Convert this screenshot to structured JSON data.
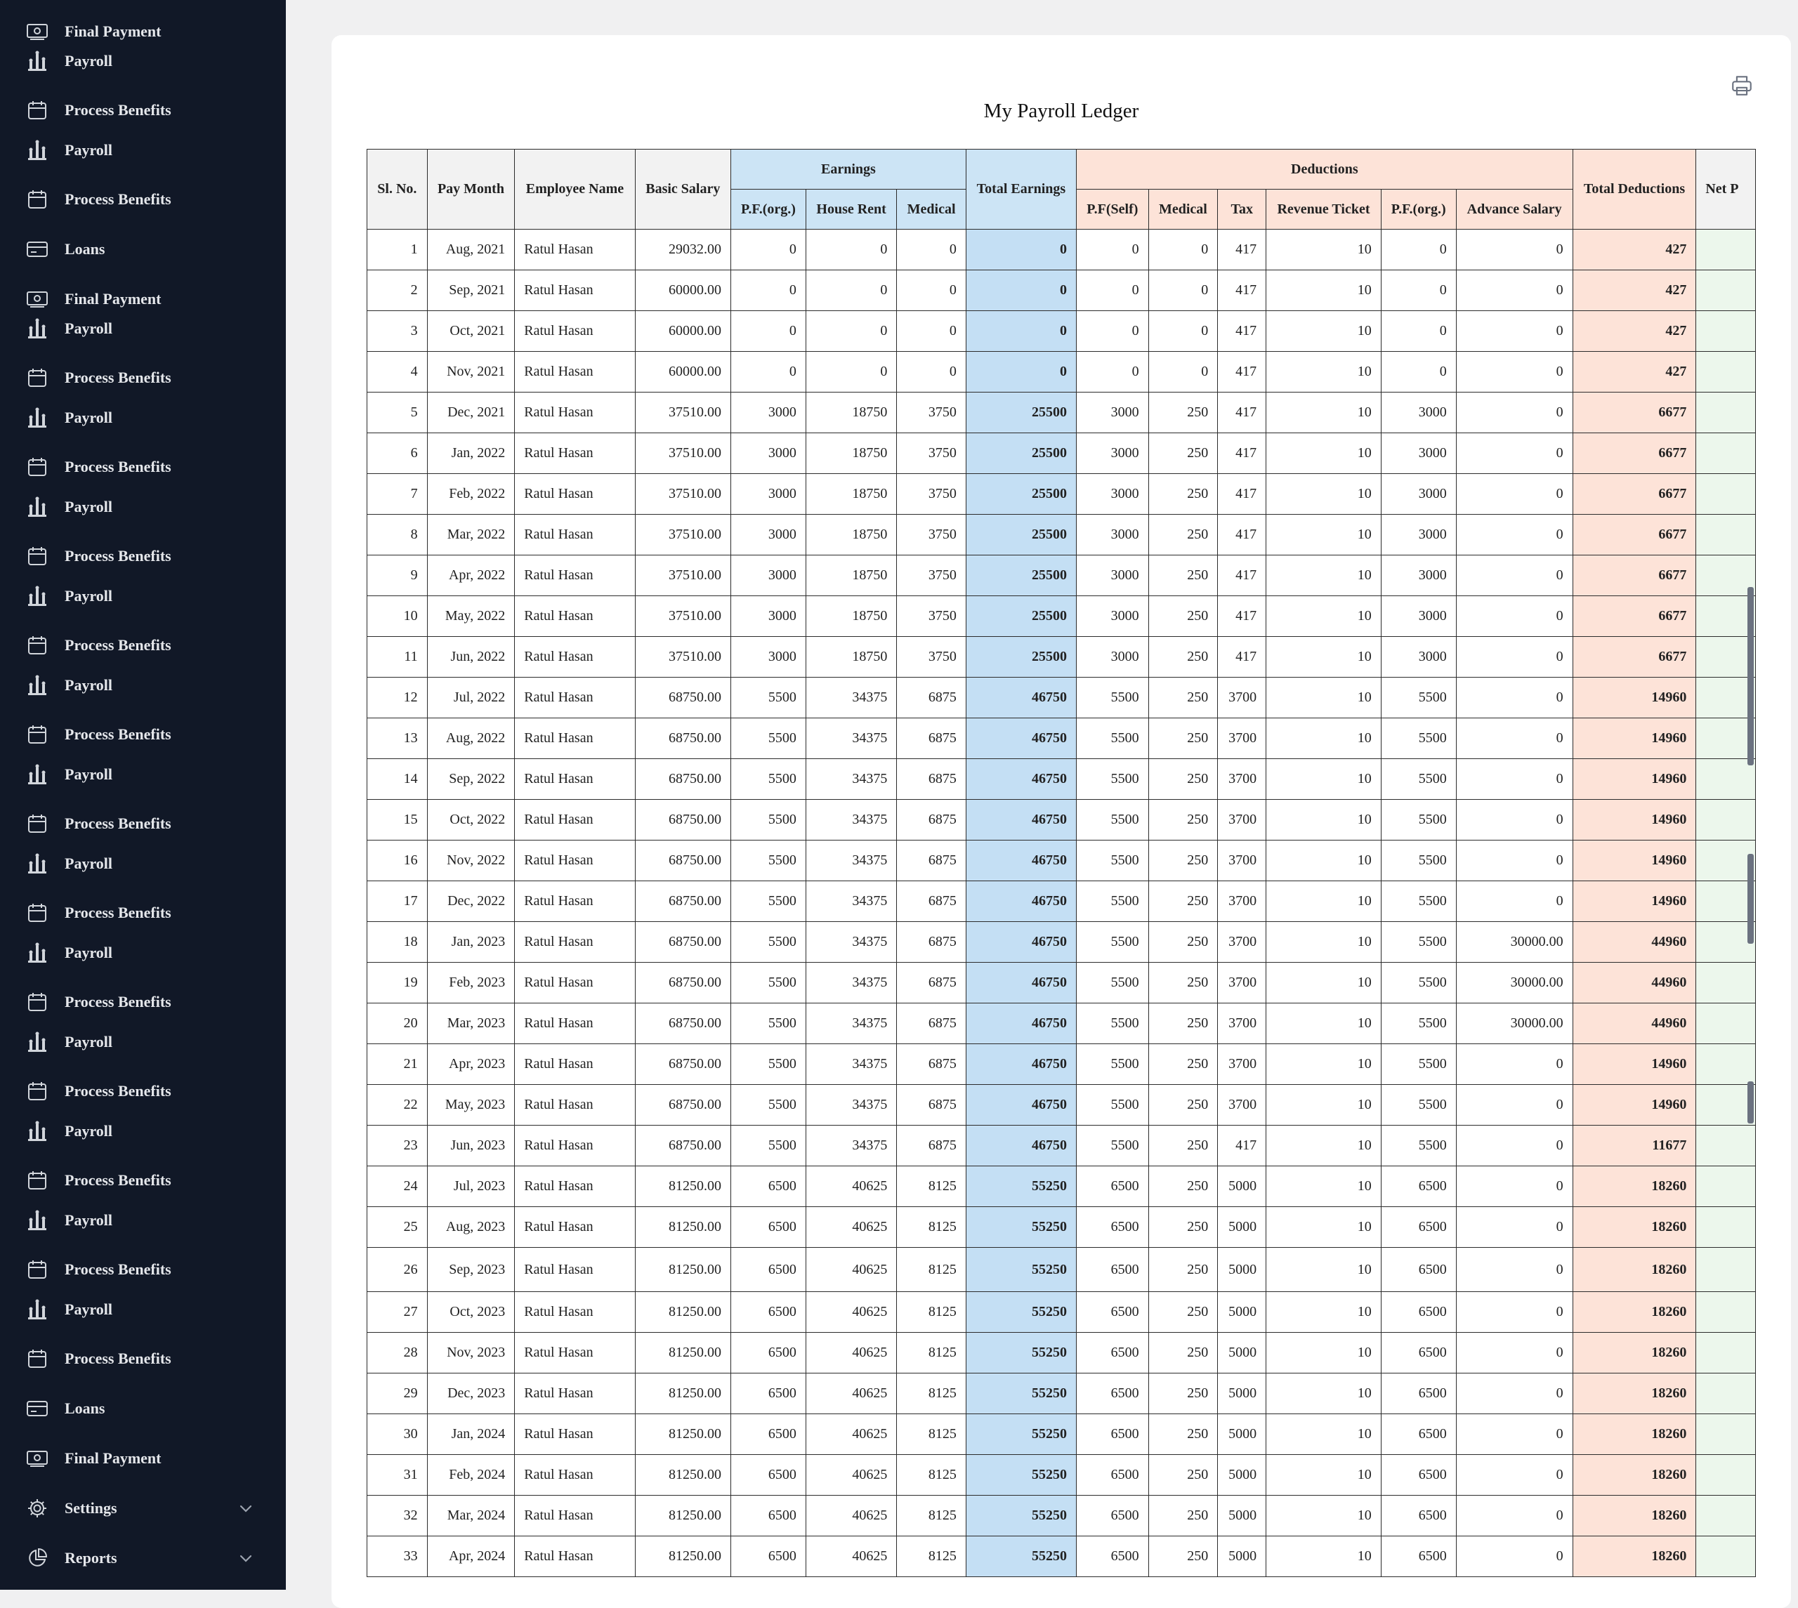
{
  "sidebar": {
    "items": [
      {
        "label": "Final Payment",
        "icon": "cash-icon"
      },
      {
        "label": "Payroll",
        "icon": "chess-icon"
      },
      {
        "label": "Process Benefits",
        "icon": "calendar-icon"
      },
      {
        "label": "Payroll",
        "icon": "chess-icon"
      },
      {
        "label": "Process Benefits",
        "icon": "calendar-icon"
      },
      {
        "label": "Loans",
        "icon": "card-icon"
      },
      {
        "label": "Final Payment",
        "icon": "cash-icon"
      },
      {
        "label": "Payroll",
        "icon": "chess-icon"
      },
      {
        "label": "Process Benefits",
        "icon": "calendar-icon"
      },
      {
        "label": "Payroll",
        "icon": "chess-icon"
      },
      {
        "label": "Process Benefits",
        "icon": "calendar-icon"
      },
      {
        "label": "Payroll",
        "icon": "chess-icon"
      },
      {
        "label": "Process Benefits",
        "icon": "calendar-icon"
      },
      {
        "label": "Payroll",
        "icon": "chess-icon"
      },
      {
        "label": "Process Benefits",
        "icon": "calendar-icon"
      },
      {
        "label": "Payroll",
        "icon": "chess-icon"
      },
      {
        "label": "Process Benefits",
        "icon": "calendar-icon"
      },
      {
        "label": "Payroll",
        "icon": "chess-icon"
      },
      {
        "label": "Process Benefits",
        "icon": "calendar-icon"
      },
      {
        "label": "Payroll",
        "icon": "chess-icon"
      },
      {
        "label": "Process Benefits",
        "icon": "calendar-icon"
      },
      {
        "label": "Payroll",
        "icon": "chess-icon"
      },
      {
        "label": "Process Benefits",
        "icon": "calendar-icon"
      },
      {
        "label": "Payroll",
        "icon": "chess-icon"
      },
      {
        "label": "Process Benefits",
        "icon": "calendar-icon"
      },
      {
        "label": "Payroll",
        "icon": "chess-icon"
      },
      {
        "label": "Process Benefits",
        "icon": "calendar-icon"
      },
      {
        "label": "Payroll",
        "icon": "chess-icon"
      },
      {
        "label": "Process Benefits",
        "icon": "calendar-icon"
      },
      {
        "label": "Payroll",
        "icon": "chess-icon"
      },
      {
        "label": "Process Benefits",
        "icon": "calendar-icon"
      },
      {
        "label": "Loans",
        "icon": "card-icon"
      },
      {
        "label": "Final Payment",
        "icon": "cash-icon"
      },
      {
        "label": "Settings",
        "icon": "gear-icon",
        "expandable": true
      },
      {
        "label": "Reports",
        "icon": "pie-chart-icon",
        "expandable": true
      }
    ]
  },
  "page": {
    "title": "My Payroll Ledger"
  },
  "table": {
    "headers": {
      "sl_no": "Sl. No.",
      "pay_month": "Pay Month",
      "employee_name": "Employee Name",
      "basic_salary": "Basic Salary",
      "earnings": "Earnings",
      "earn_pf_org": "P.F.(org.)",
      "earn_house_rent": "House Rent",
      "earn_medical": "Medical",
      "total_earnings": "Total Earnings",
      "deductions": "Deductions",
      "ded_pf_self": "P.F(Self)",
      "ded_medical": "Medical",
      "ded_tax": "Tax",
      "ded_revenue_ticket": "Revenue Ticket",
      "ded_pf_org": "P.F.(org.)",
      "ded_advance_salary": "Advance Salary",
      "total_deductions": "Total Deductions",
      "net_pay": "Net P"
    },
    "rows": [
      [
        "1",
        "Aug, 2021",
        "Ratul Hasan",
        "29032.00",
        "0",
        "0",
        "0",
        "0",
        "0",
        "0",
        "417",
        "10",
        "0",
        "0",
        "427",
        ""
      ],
      [
        "2",
        "Sep, 2021",
        "Ratul Hasan",
        "60000.00",
        "0",
        "0",
        "0",
        "0",
        "0",
        "0",
        "417",
        "10",
        "0",
        "0",
        "427",
        ""
      ],
      [
        "3",
        "Oct, 2021",
        "Ratul Hasan",
        "60000.00",
        "0",
        "0",
        "0",
        "0",
        "0",
        "0",
        "417",
        "10",
        "0",
        "0",
        "427",
        ""
      ],
      [
        "4",
        "Nov, 2021",
        "Ratul Hasan",
        "60000.00",
        "0",
        "0",
        "0",
        "0",
        "0",
        "0",
        "417",
        "10",
        "0",
        "0",
        "427",
        ""
      ],
      [
        "5",
        "Dec, 2021",
        "Ratul Hasan",
        "37510.00",
        "3000",
        "18750",
        "3750",
        "25500",
        "3000",
        "250",
        "417",
        "10",
        "3000",
        "0",
        "6677",
        ""
      ],
      [
        "6",
        "Jan, 2022",
        "Ratul Hasan",
        "37510.00",
        "3000",
        "18750",
        "3750",
        "25500",
        "3000",
        "250",
        "417",
        "10",
        "3000",
        "0",
        "6677",
        ""
      ],
      [
        "7",
        "Feb, 2022",
        "Ratul Hasan",
        "37510.00",
        "3000",
        "18750",
        "3750",
        "25500",
        "3000",
        "250",
        "417",
        "10",
        "3000",
        "0",
        "6677",
        ""
      ],
      [
        "8",
        "Mar, 2022",
        "Ratul Hasan",
        "37510.00",
        "3000",
        "18750",
        "3750",
        "25500",
        "3000",
        "250",
        "417",
        "10",
        "3000",
        "0",
        "6677",
        ""
      ],
      [
        "9",
        "Apr, 2022",
        "Ratul Hasan",
        "37510.00",
        "3000",
        "18750",
        "3750",
        "25500",
        "3000",
        "250",
        "417",
        "10",
        "3000",
        "0",
        "6677",
        ""
      ],
      [
        "10",
        "May, 2022",
        "Ratul Hasan",
        "37510.00",
        "3000",
        "18750",
        "3750",
        "25500",
        "3000",
        "250",
        "417",
        "10",
        "3000",
        "0",
        "6677",
        ""
      ],
      [
        "11",
        "Jun, 2022",
        "Ratul Hasan",
        "37510.00",
        "3000",
        "18750",
        "3750",
        "25500",
        "3000",
        "250",
        "417",
        "10",
        "3000",
        "0",
        "6677",
        ""
      ],
      [
        "12",
        "Jul, 2022",
        "Ratul Hasan",
        "68750.00",
        "5500",
        "34375",
        "6875",
        "46750",
        "5500",
        "250",
        "3700",
        "10",
        "5500",
        "0",
        "14960",
        ""
      ],
      [
        "13",
        "Aug, 2022",
        "Ratul Hasan",
        "68750.00",
        "5500",
        "34375",
        "6875",
        "46750",
        "5500",
        "250",
        "3700",
        "10",
        "5500",
        "0",
        "14960",
        ""
      ],
      [
        "14",
        "Sep, 2022",
        "Ratul Hasan",
        "68750.00",
        "5500",
        "34375",
        "6875",
        "46750",
        "5500",
        "250",
        "3700",
        "10",
        "5500",
        "0",
        "14960",
        ""
      ],
      [
        "15",
        "Oct, 2022",
        "Ratul Hasan",
        "68750.00",
        "5500",
        "34375",
        "6875",
        "46750",
        "5500",
        "250",
        "3700",
        "10",
        "5500",
        "0",
        "14960",
        ""
      ],
      [
        "16",
        "Nov, 2022",
        "Ratul Hasan",
        "68750.00",
        "5500",
        "34375",
        "6875",
        "46750",
        "5500",
        "250",
        "3700",
        "10",
        "5500",
        "0",
        "14960",
        ""
      ],
      [
        "17",
        "Dec, 2022",
        "Ratul Hasan",
        "68750.00",
        "5500",
        "34375",
        "6875",
        "46750",
        "5500",
        "250",
        "3700",
        "10",
        "5500",
        "0",
        "14960",
        ""
      ],
      [
        "18",
        "Jan, 2023",
        "Ratul Hasan",
        "68750.00",
        "5500",
        "34375",
        "6875",
        "46750",
        "5500",
        "250",
        "3700",
        "10",
        "5500",
        "30000.00",
        "44960",
        ""
      ],
      [
        "19",
        "Feb, 2023",
        "Ratul Hasan",
        "68750.00",
        "5500",
        "34375",
        "6875",
        "46750",
        "5500",
        "250",
        "3700",
        "10",
        "5500",
        "30000.00",
        "44960",
        ""
      ],
      [
        "20",
        "Mar, 2023",
        "Ratul Hasan",
        "68750.00",
        "5500",
        "34375",
        "6875",
        "46750",
        "5500",
        "250",
        "3700",
        "10",
        "5500",
        "30000.00",
        "44960",
        ""
      ],
      [
        "21",
        "Apr, 2023",
        "Ratul Hasan",
        "68750.00",
        "5500",
        "34375",
        "6875",
        "46750",
        "5500",
        "250",
        "3700",
        "10",
        "5500",
        "0",
        "14960",
        ""
      ],
      [
        "22",
        "May, 2023",
        "Ratul Hasan",
        "68750.00",
        "5500",
        "34375",
        "6875",
        "46750",
        "5500",
        "250",
        "3700",
        "10",
        "5500",
        "0",
        "14960",
        ""
      ],
      [
        "23",
        "Jun, 2023",
        "Ratul Hasan",
        "68750.00",
        "5500",
        "34375",
        "6875",
        "46750",
        "5500",
        "250",
        "417",
        "10",
        "5500",
        "0",
        "11677",
        ""
      ],
      [
        "24",
        "Jul, 2023",
        "Ratul Hasan",
        "81250.00",
        "6500",
        "40625",
        "8125",
        "55250",
        "6500",
        "250",
        "5000",
        "10",
        "6500",
        "0",
        "18260",
        ""
      ],
      [
        "25",
        "Aug, 2023",
        "Ratul Hasan",
        "81250.00",
        "6500",
        "40625",
        "8125",
        "55250",
        "6500",
        "250",
        "5000",
        "10",
        "6500",
        "0",
        "18260",
        ""
      ],
      [
        "26",
        "Sep, 2023",
        "Ratul Hasan",
        "81250.00",
        "6500",
        "40625",
        "8125",
        "55250",
        "6500",
        "250",
        "5000",
        "10",
        "6500",
        "0",
        "18260",
        ""
      ],
      [
        "27",
        "Oct, 2023",
        "Ratul Hasan",
        "81250.00",
        "6500",
        "40625",
        "8125",
        "55250",
        "6500",
        "250",
        "5000",
        "10",
        "6500",
        "0",
        "18260",
        ""
      ],
      [
        "28",
        "Nov, 2023",
        "Ratul Hasan",
        "81250.00",
        "6500",
        "40625",
        "8125",
        "55250",
        "6500",
        "250",
        "5000",
        "10",
        "6500",
        "0",
        "18260",
        ""
      ],
      [
        "29",
        "Dec, 2023",
        "Ratul Hasan",
        "81250.00",
        "6500",
        "40625",
        "8125",
        "55250",
        "6500",
        "250",
        "5000",
        "10",
        "6500",
        "0",
        "18260",
        ""
      ],
      [
        "30",
        "Jan, 2024",
        "Ratul Hasan",
        "81250.00",
        "6500",
        "40625",
        "8125",
        "55250",
        "6500",
        "250",
        "5000",
        "10",
        "6500",
        "0",
        "18260",
        ""
      ],
      [
        "31",
        "Feb, 2024",
        "Ratul Hasan",
        "81250.00",
        "6500",
        "40625",
        "8125",
        "55250",
        "6500",
        "250",
        "5000",
        "10",
        "6500",
        "0",
        "18260",
        ""
      ],
      [
        "32",
        "Mar, 2024",
        "Ratul Hasan",
        "81250.00",
        "6500",
        "40625",
        "8125",
        "55250",
        "6500",
        "250",
        "5000",
        "10",
        "6500",
        "0",
        "18260",
        ""
      ],
      [
        "33",
        "Apr, 2024",
        "Ratul Hasan",
        "81250.00",
        "6500",
        "40625",
        "8125",
        "55250",
        "6500",
        "250",
        "5000",
        "10",
        "6500",
        "0",
        "18260",
        ""
      ]
    ]
  },
  "colors": {
    "sidebar_bg": "#111827",
    "earnings_header": "#cce4f5",
    "deductions_header": "#fde3d8",
    "net_pay_cell": "#ecf7ec"
  }
}
